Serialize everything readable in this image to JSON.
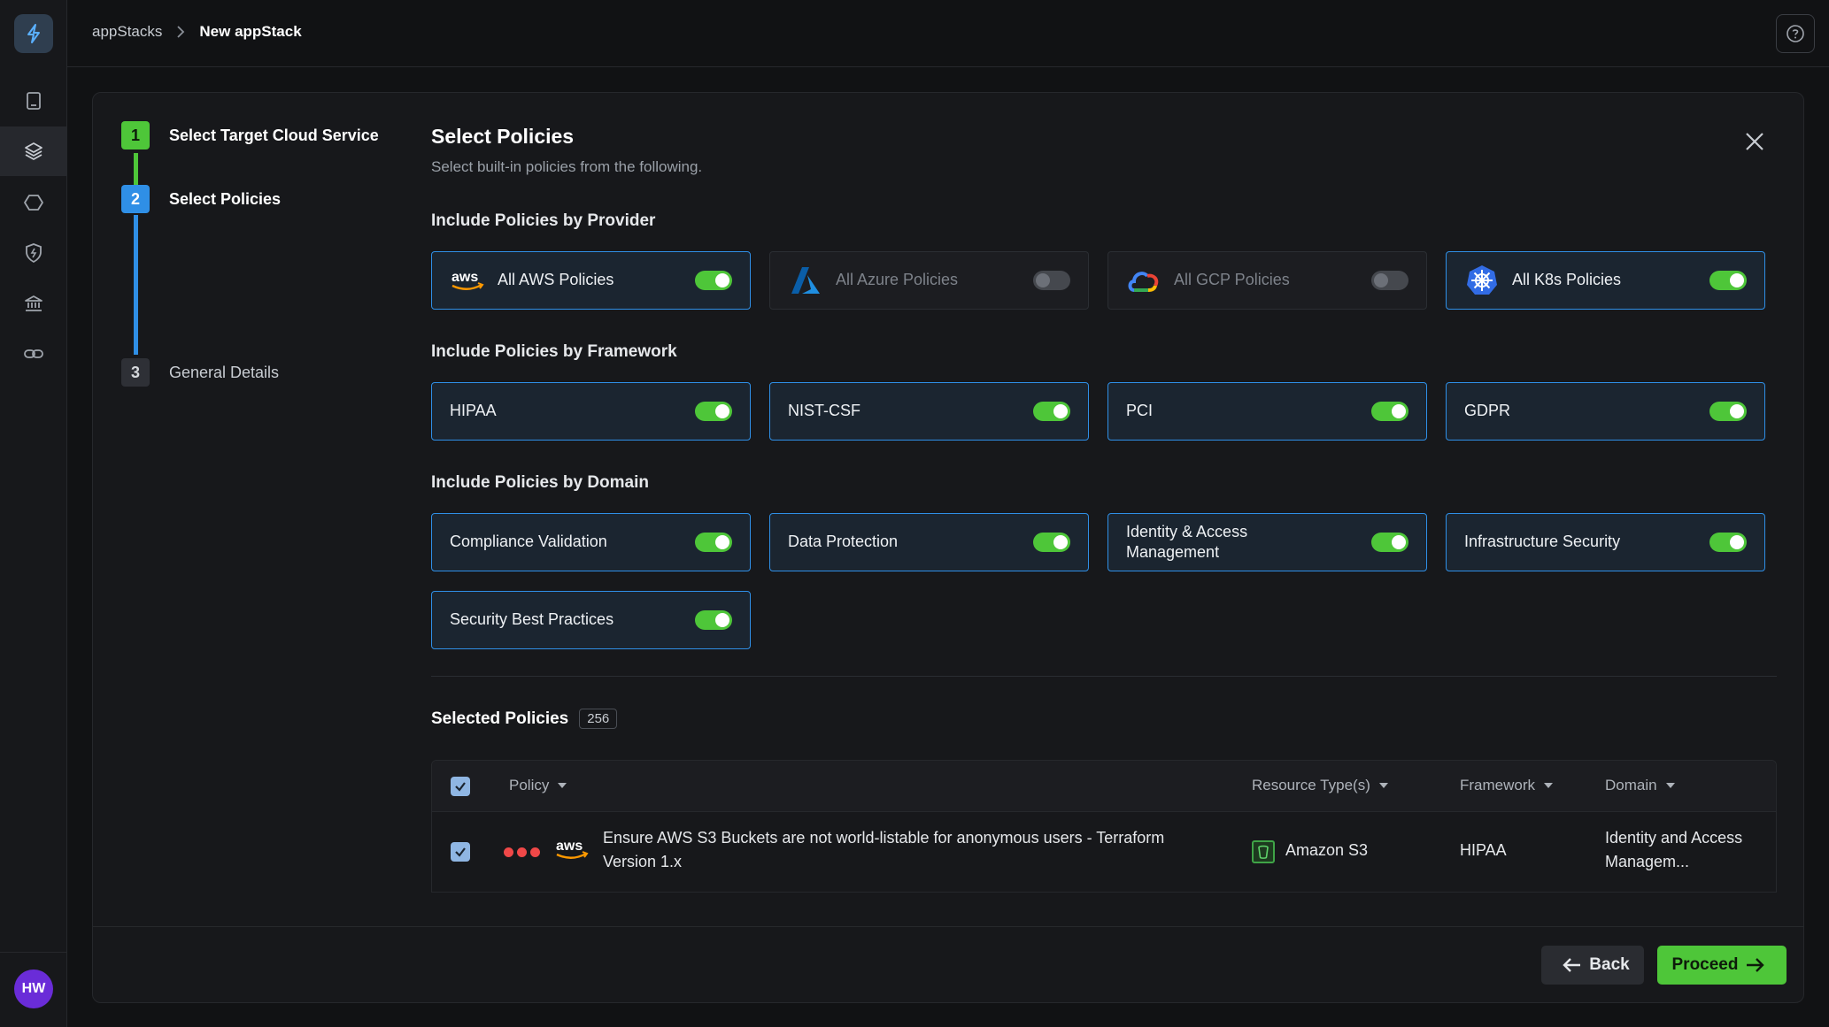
{
  "breadcrumb": {
    "parent": "appStacks",
    "current": "New appStack"
  },
  "user": {
    "initials": "HW"
  },
  "stepper": [
    {
      "num": "1",
      "label": "Select Target Cloud Service",
      "state": "done"
    },
    {
      "num": "2",
      "label": "Select Policies",
      "state": "active"
    },
    {
      "num": "3",
      "label": "General Details",
      "state": "pending"
    }
  ],
  "header": {
    "title": "Select Policies",
    "subtitle": "Select built-in policies from the following."
  },
  "sections": {
    "provider": "Include Policies by Provider",
    "framework": "Include Policies by Framework",
    "domain": "Include Policies by Domain"
  },
  "providers": [
    {
      "label": "All AWS Policies",
      "on": true,
      "icon": "aws-logo-icon"
    },
    {
      "label": "All Azure Policies",
      "on": false,
      "icon": "azure-logo-icon"
    },
    {
      "label": "All GCP Policies",
      "on": false,
      "icon": "gcp-logo-icon"
    },
    {
      "label": "All K8s Policies",
      "on": true,
      "icon": "kubernetes-logo-icon"
    }
  ],
  "frameworks": [
    {
      "label": "HIPAA",
      "on": true
    },
    {
      "label": "NIST-CSF",
      "on": true
    },
    {
      "label": "PCI",
      "on": true
    },
    {
      "label": "GDPR",
      "on": true
    }
  ],
  "domains": [
    {
      "label": "Compliance Validation",
      "on": true
    },
    {
      "label": "Data Protection",
      "on": true
    },
    {
      "label": "Identity & Access Management",
      "on": true
    },
    {
      "label": "Infrastructure Security",
      "on": true
    },
    {
      "label": "Security Best Practices",
      "on": true
    }
  ],
  "selected": {
    "title": "Selected Policies",
    "count": "256"
  },
  "table": {
    "columns": {
      "policy": "Policy",
      "resource": "Resource Type(s)",
      "framework": "Framework",
      "domain": "Domain"
    },
    "rows": [
      {
        "policy": "Ensure AWS S3 Buckets are not world-listable for anonymous users - Terraform Version 1.x",
        "resource": "Amazon S3",
        "framework": "HIPAA",
        "domain": "Identity and Access Managem..."
      }
    ]
  },
  "buttons": {
    "back": "Back",
    "proceed": "Proceed"
  },
  "colors": {
    "accent_blue": "#2f8fe6",
    "accent_green": "#4ec639",
    "severity_red": "#f04848"
  }
}
